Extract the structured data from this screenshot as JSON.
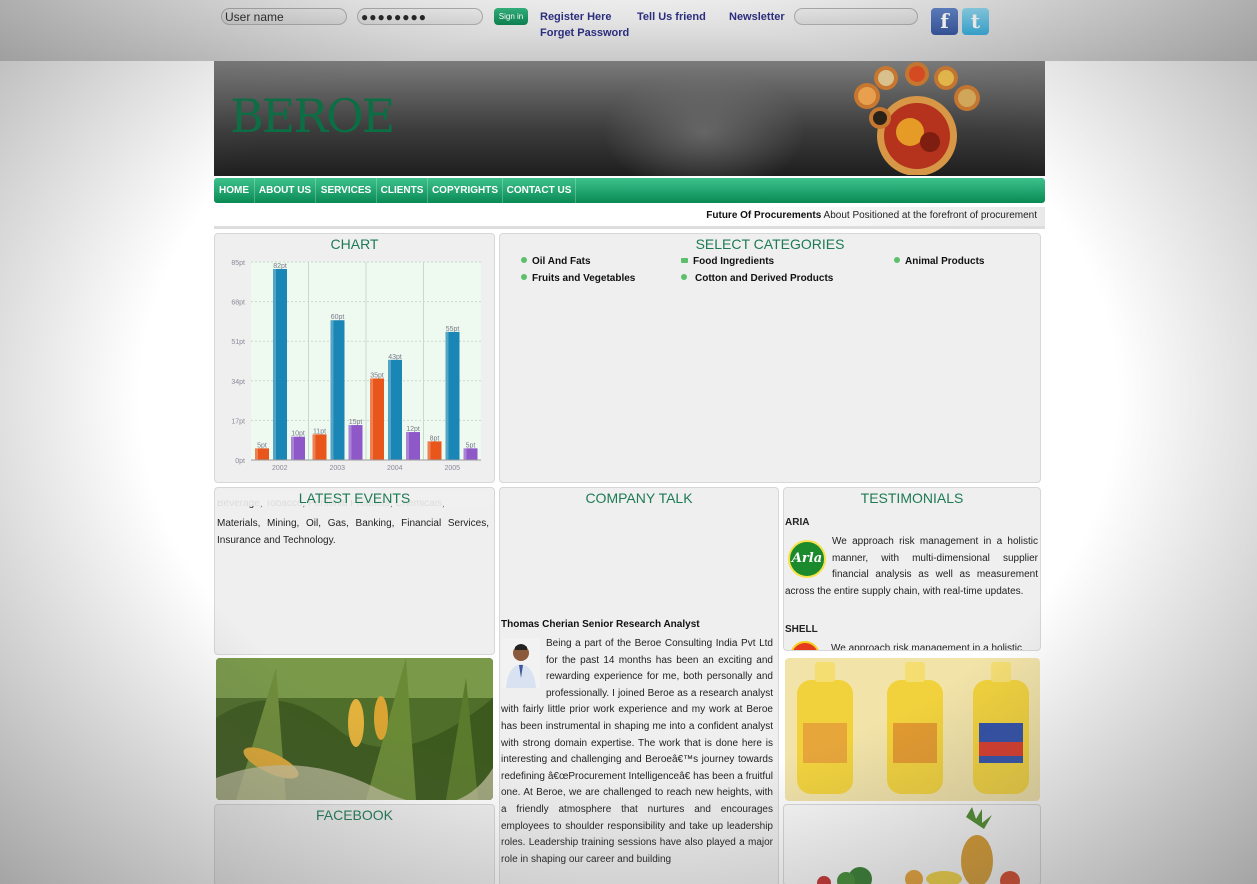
{
  "topbar": {
    "username_value": "User name",
    "password_value": "●●●●●●●●",
    "signin_label": "Sign in",
    "register_label": "Register Here",
    "tell_friend_label": "Tell Us friend",
    "newsletter_label": "Newsletter",
    "forget_password_label": "Forget Password",
    "newsletter_value": "",
    "facebook_glyph": "f",
    "twitter_glyph": "t"
  },
  "banner": {
    "logo_text": "BEROE"
  },
  "nav": {
    "items": [
      {
        "label": "HOME"
      },
      {
        "label": "ABOUT US"
      },
      {
        "label": "SERVICES"
      },
      {
        "label": "CLIENTS"
      },
      {
        "label": "COPYRIGHTS"
      },
      {
        "label": "CONTACT US"
      }
    ]
  },
  "ticker": {
    "bold_text": "Future Of Procurements",
    "text": "About Positioned at the forefront of procurement"
  },
  "chart_panel": {
    "title": "CHART"
  },
  "chart_data": {
    "type": "bar",
    "categories": [
      "2002",
      "2003",
      "2004",
      "2005"
    ],
    "ylim": [
      0,
      85
    ],
    "yticks": [
      "0pt",
      "17pt",
      "34pt",
      "51pt",
      "68pt",
      "85pt"
    ],
    "series": [
      {
        "values": [
          5,
          11,
          35,
          8
        ],
        "labels": [
          "5pt",
          "11pt",
          "35pt",
          "8pt"
        ],
        "color": "#e8561b"
      },
      {
        "values": [
          82,
          60,
          43,
          55
        ],
        "labels": [
          "82pt",
          "60pt",
          "43pt",
          "55pt"
        ],
        "color": "#1a86b5"
      },
      {
        "values": [
          10,
          15,
          12,
          5
        ],
        "labels": [
          "10pt",
          "15pt",
          "12pt",
          "5pt"
        ],
        "color": "#8e58c9"
      }
    ]
  },
  "categories_panel": {
    "title": "SELECT CATEGORIES",
    "items": [
      {
        "label": "Oil And Fats"
      },
      {
        "label": "Food Ingredients"
      },
      {
        "label": "Animal Products"
      },
      {
        "label": "Fruits and Vegetables"
      },
      {
        "label": "Cotton and Derived Products"
      }
    ]
  },
  "events_panel": {
    "title": "LATEST EVENTS",
    "cut_line": "Beverage,   Tobacco,   Personal   Products,   Chemicals,",
    "text": "Materials, Mining, Oil, Gas, Banking, Financial Services, Insurance and Technology."
  },
  "company_panel": {
    "title": "COMPANY TALK",
    "author": "Thomas Cherian Senior Research Analyst",
    "text": "Being a part of the Beroe Consulting India Pvt Ltd for the past 14 months has been an exciting and rewarding experience for me, both personally and professionally. I joined Beroe as a research analyst with fairly little prior work experience and my work at Beroe has been instrumental in shaping me into a confident analyst with strong domain expertise. The work that is done here is interesting and challenging and Beroeâ€™s journey towards redefining â€œProcurement Intelligenceâ€ has been a fruitful one. At Beroe, we are challenged to reach new heights, with a friendly atmosphere that nurtures and encourages employees to shoulder responsibility and take up leadership roles. Leadership training sessions have also played a major role in shaping our career and building"
  },
  "testimonials_panel": {
    "title": "TESTIMONIALS",
    "items": [
      {
        "company": "ARIA",
        "logo_text": "Arla",
        "text": "We approach risk management in a holistic manner, with multi-dimensional supplier financial analysis as well as measurement across the entire supply chain, with real-time updates."
      },
      {
        "company": "SHELL",
        "text": "We approach risk management in a holistic"
      }
    ]
  },
  "facebook_panel": {
    "title": "FACEBOOK"
  }
}
